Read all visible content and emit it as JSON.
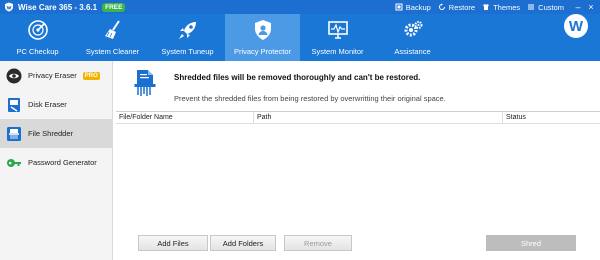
{
  "window": {
    "title": "Wise Care 365 - 3.6.1",
    "badge": "FREE",
    "actions": [
      {
        "label": "Backup",
        "icon": "backup-icon"
      },
      {
        "label": "Restore",
        "icon": "restore-icon"
      },
      {
        "label": "Themes",
        "icon": "themes-icon"
      },
      {
        "label": "Custom",
        "icon": "custom-icon"
      }
    ],
    "controls": {
      "minimize": "–",
      "close": "×"
    }
  },
  "nav": {
    "tabs": [
      {
        "label": "PC Checkup",
        "icon": "pc-checkup-icon"
      },
      {
        "label": "System Cleaner",
        "icon": "broom-icon"
      },
      {
        "label": "System Tuneup",
        "icon": "rocket-icon"
      },
      {
        "label": "Privacy Protector",
        "icon": "shield-user-icon",
        "active": true
      },
      {
        "label": "System Monitor",
        "icon": "monitor-icon"
      },
      {
        "label": "Assistance",
        "icon": "gears-icon"
      }
    ],
    "avatar": "W"
  },
  "sidebar": {
    "items": [
      {
        "label": "Privacy Eraser",
        "icon": "eye-icon",
        "badge": "PRO"
      },
      {
        "label": "Disk Eraser",
        "icon": "disk-icon"
      },
      {
        "label": "File Shredder",
        "icon": "shredder-icon",
        "active": true
      },
      {
        "label": "Password Generator",
        "icon": "key-icon"
      }
    ]
  },
  "main": {
    "headline": "Shredded files will be removed thoroughly and can't be restored.",
    "subline": "Prevent the shredded files from being restored by overwritting their original space.",
    "columns": [
      "File/Folder Name",
      "Path",
      "Status"
    ],
    "rows": [],
    "buttons": {
      "add_files": "Add Files",
      "add_folders": "Add Folders",
      "remove": "Remove",
      "shred": "Shred"
    }
  },
  "colors": {
    "titlebar": "#1c6fd1",
    "navbar": "#1a77d6",
    "nav_active": "#4c9ae6",
    "free_badge": "#3bb54a",
    "pro_badge": "#f0b400"
  }
}
